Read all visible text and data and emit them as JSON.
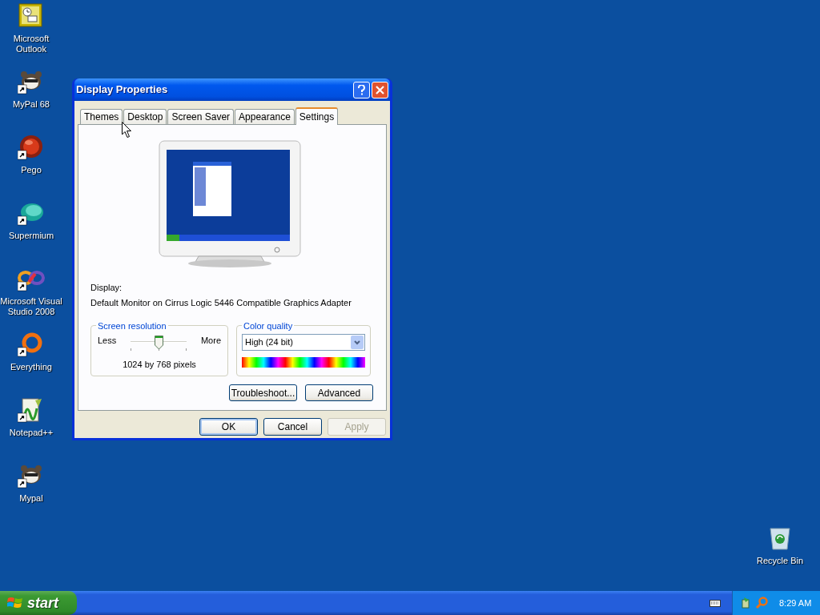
{
  "desktop_icons": [
    {
      "label": "Microsoft Outlook",
      "kind": "outlook",
      "shortcut": false
    },
    {
      "label": "MyPal 68",
      "kind": "raccoon",
      "shortcut": true
    },
    {
      "label": "Pego",
      "kind": "orb",
      "shortcut": true
    },
    {
      "label": "Supermium",
      "kind": "cloud",
      "shortcut": true
    },
    {
      "label": "Microsoft Visual Studio 2008",
      "kind": "infinity",
      "shortcut": true
    },
    {
      "label": "Everything",
      "kind": "ring",
      "shortcut": true
    },
    {
      "label": "Notepad++",
      "kind": "notepad",
      "shortcut": true
    },
    {
      "label": "Mypal",
      "kind": "raccoon",
      "shortcut": true
    }
  ],
  "window": {
    "title": "Display Properties",
    "tabs": [
      {
        "label": "Themes",
        "selected": false
      },
      {
        "label": "Desktop",
        "selected": false
      },
      {
        "label": "Screen Saver",
        "selected": false
      },
      {
        "label": "Appearance",
        "selected": false
      },
      {
        "label": "Settings",
        "selected": true
      }
    ],
    "display_label": "Display:",
    "display_value": "Default Monitor on Cirrus Logic 5446 Compatible Graphics Adapter",
    "screen_resolution": {
      "title": "Screen resolution",
      "min_label": "Less",
      "max_label": "More",
      "level": 0.5,
      "reading": "1024 by 768 pixels"
    },
    "color_quality": {
      "title": "Color quality",
      "value": "High (24 bit)"
    },
    "panel_buttons": [
      "Troubleshoot...",
      "Advanced"
    ],
    "dialog_buttons": [
      {
        "label": "OK",
        "default": true,
        "disabled": false
      },
      {
        "label": "Cancel",
        "default": false,
        "disabled": false
      },
      {
        "label": "Apply",
        "default": false,
        "disabled": true
      }
    ]
  },
  "recycle_bin": {
    "label": "Recycle Bin"
  },
  "taskbar": {
    "start": "start",
    "clock": "8:29 AM"
  }
}
